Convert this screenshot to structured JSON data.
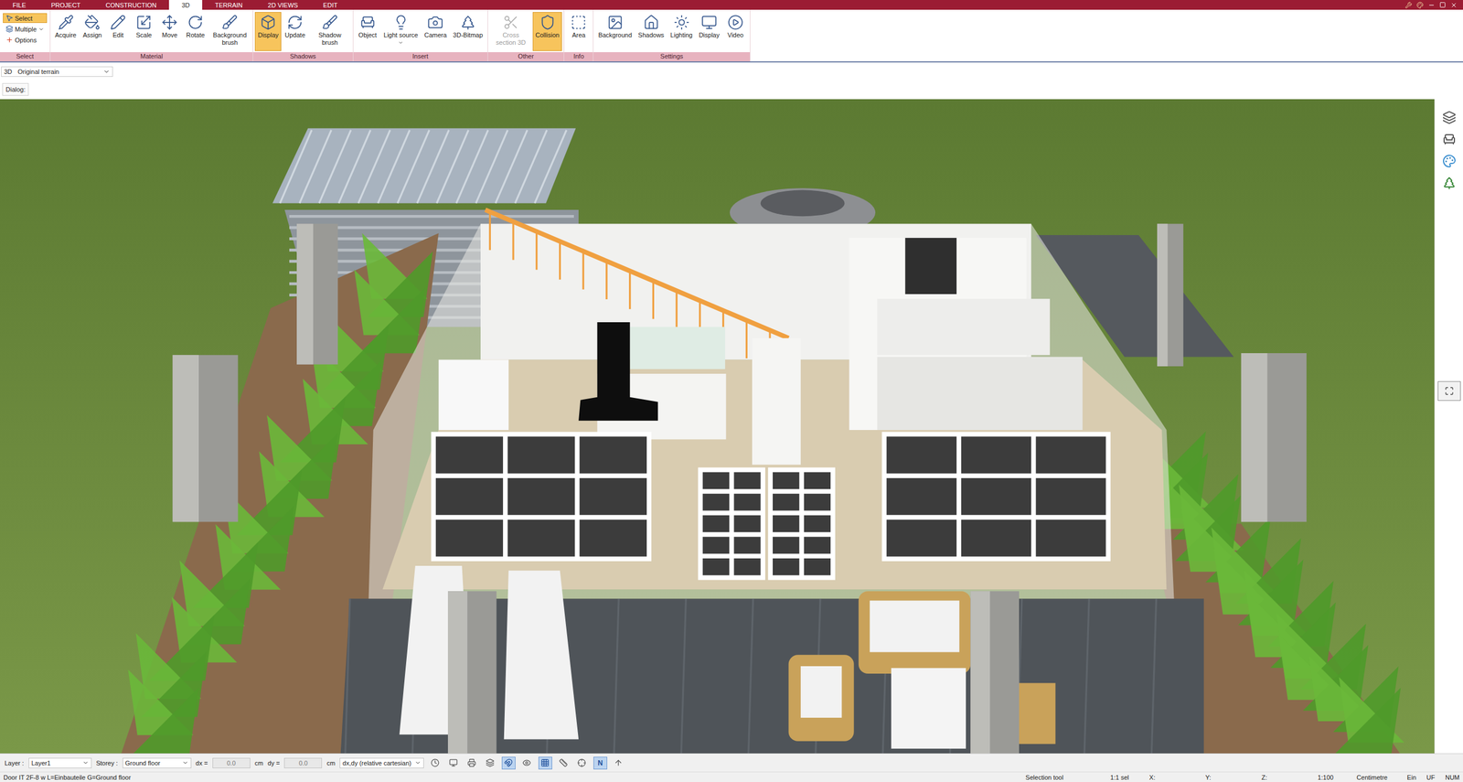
{
  "menu_tabs": [
    {
      "label": "FILE",
      "selected": false
    },
    {
      "label": "PROJECT",
      "selected": false
    },
    {
      "label": "CONSTRUCTION",
      "selected": false
    },
    {
      "label": "3D",
      "selected": true
    },
    {
      "label": "TERRAIN",
      "selected": false
    },
    {
      "label": "2D VIEWS",
      "selected": false
    },
    {
      "label": "EDIT",
      "selected": false
    }
  ],
  "ribbon": {
    "groups": [
      {
        "label": "Select",
        "kind": "stack",
        "buttons": [
          {
            "label": "Select",
            "selected": true,
            "disabled": false,
            "dropdown": false
          },
          {
            "label": "Multiple",
            "selected": false,
            "disabled": false,
            "dropdown": true
          },
          {
            "label": "Options",
            "selected": false,
            "disabled": false,
            "dropdown": false
          }
        ]
      },
      {
        "label": "Material",
        "kind": "large",
        "buttons": [
          {
            "label": "Acquire",
            "selected": false,
            "disabled": false,
            "dropdown": false
          },
          {
            "label": "Assign",
            "selected": false,
            "disabled": false,
            "dropdown": false
          },
          {
            "label": "Edit",
            "selected": false,
            "disabled": false,
            "dropdown": false
          },
          {
            "label": "Scale",
            "selected": false,
            "disabled": false,
            "dropdown": false
          },
          {
            "label": "Move",
            "selected": false,
            "disabled": false,
            "dropdown": false
          },
          {
            "label": "Rotate",
            "selected": false,
            "disabled": false,
            "dropdown": false
          },
          {
            "label": "Background brush",
            "selected": false,
            "disabled": false,
            "dropdown": false
          }
        ]
      },
      {
        "label": "Shadows",
        "kind": "large",
        "buttons": [
          {
            "label": "Display",
            "selected": true,
            "disabled": false,
            "dropdown": false
          },
          {
            "label": "Update",
            "selected": false,
            "disabled": false,
            "dropdown": false
          },
          {
            "label": "Shadow brush",
            "selected": false,
            "disabled": false,
            "dropdown": false
          }
        ]
      },
      {
        "label": "Insert",
        "kind": "large",
        "buttons": [
          {
            "label": "Object",
            "selected": false,
            "disabled": false,
            "dropdown": false
          },
          {
            "label": "Light source",
            "selected": false,
            "disabled": false,
            "dropdown": true
          },
          {
            "label": "Camera",
            "selected": false,
            "disabled": false,
            "dropdown": false
          },
          {
            "label": "3D-Bitmap",
            "selected": false,
            "disabled": false,
            "dropdown": false
          }
        ]
      },
      {
        "label": "Other",
        "kind": "large",
        "buttons": [
          {
            "label": "Cross section 3D",
            "selected": false,
            "disabled": true,
            "dropdown": false
          },
          {
            "label": "Collision",
            "selected": true,
            "disabled": false,
            "dropdown": false
          }
        ]
      },
      {
        "label": "Info",
        "kind": "large",
        "buttons": [
          {
            "label": "Area",
            "selected": false,
            "disabled": false,
            "dropdown": false
          }
        ]
      },
      {
        "label": "Settings",
        "kind": "large",
        "buttons": [
          {
            "label": "Background",
            "selected": false,
            "disabled": false,
            "dropdown": false
          },
          {
            "label": "Shadows",
            "selected": false,
            "disabled": false,
            "dropdown": false
          },
          {
            "label": "Lighting",
            "selected": false,
            "disabled": false,
            "dropdown": false
          },
          {
            "label": "Display",
            "selected": false,
            "disabled": false,
            "dropdown": false
          },
          {
            "label": "Video",
            "selected": false,
            "disabled": false,
            "dropdown": false
          }
        ]
      }
    ]
  },
  "view_bar": {
    "mode": "3D",
    "terrain": "Original terrain"
  },
  "dialog": {
    "label": "Dialog:"
  },
  "bottom_bar": {
    "layer_label": "Layer :",
    "layer": "Layer1",
    "storey_label": "Storey :",
    "storey": "Ground floor",
    "dx_label": "dx =",
    "dx": "0.0",
    "dx_unit": "cm",
    "dy_label": "dy =",
    "dy": "0.0",
    "dy_unit": "cm",
    "coord_mode": "dx,dy (relative cartesian)",
    "tools": [
      {
        "kind": "icon",
        "label": "",
        "selected": false
      },
      {
        "kind": "icon",
        "label": "",
        "selected": false
      },
      {
        "kind": "icon",
        "label": "",
        "selected": false
      },
      {
        "kind": "icon",
        "label": "",
        "selected": false
      },
      {
        "kind": "icon",
        "label": "",
        "selected": true
      },
      {
        "kind": "icon",
        "label": "",
        "selected": false
      },
      {
        "kind": "icon",
        "label": "",
        "selected": true
      },
      {
        "kind": "icon",
        "label": "",
        "selected": false
      },
      {
        "kind": "icon",
        "label": "",
        "selected": false
      },
      {
        "kind": "label",
        "label": "N",
        "selected": true
      },
      {
        "kind": "icon",
        "label": "",
        "selected": false
      }
    ]
  },
  "status_bar": {
    "message": "Door IT 2F-8 w L=Einbauteile G=Ground floor",
    "tool": "Selection tool",
    "selection": "1:1 sel",
    "x": "X:",
    "y": "Y:",
    "z": "Z:",
    "scale": "1:100",
    "unit": "Centimetre",
    "snap": "Ein",
    "uf": "UF",
    "num": "NUM"
  }
}
